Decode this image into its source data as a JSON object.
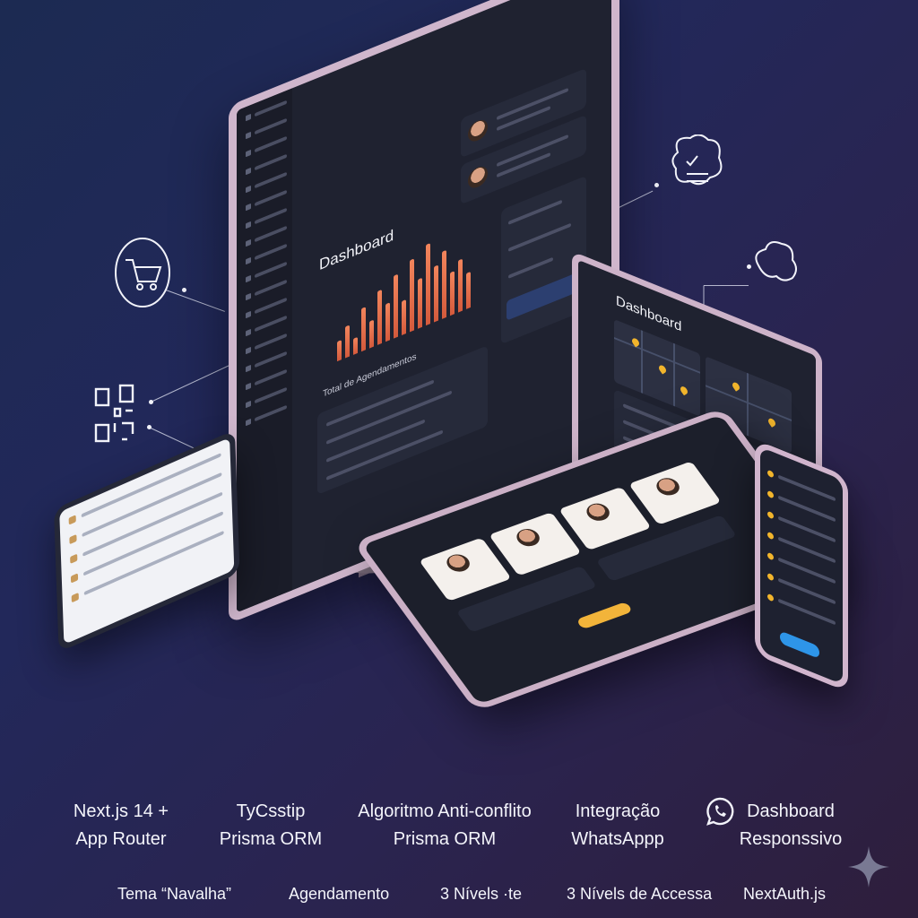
{
  "monitor": {
    "title": "Dashboard",
    "chart_label": "Total de Agendamentos",
    "bars": [
      22,
      35,
      18,
      48,
      30,
      60,
      42,
      70,
      38,
      80,
      55,
      90,
      62,
      75,
      48,
      58,
      40
    ]
  },
  "second_monitor": {
    "title": "Dashboard"
  },
  "features_row1": [
    {
      "line1": "Next.js 14 +",
      "line2": "App Router"
    },
    {
      "line1": "TyCsstip",
      "line2": "Prisma ORM"
    },
    {
      "line1": "Algoritmo Anti-conflito",
      "line2": "Prisma ORM"
    },
    {
      "line1": "Integração",
      "line2": "WhatsAppp"
    },
    {
      "line1": "Dashboard",
      "line2": "Responssivo"
    }
  ],
  "features_row2": [
    "Tema “Navalha”",
    "Agendamento",
    "3 Nívels ·te",
    "3 Nívels de Accessa",
    "NextAuth.js"
  ],
  "icons": [
    "shopping-cart-icon",
    "qr-code-icon",
    "truck-icon",
    "truck-icon",
    "chat-checklist-icon",
    "cloud-icon",
    "whatsapp-icon",
    "sparkle-icon"
  ],
  "colors": {
    "accent_orange": "#f2855c",
    "accent_yellow": "#f2b52c",
    "accent_blue": "#2e95e8"
  }
}
